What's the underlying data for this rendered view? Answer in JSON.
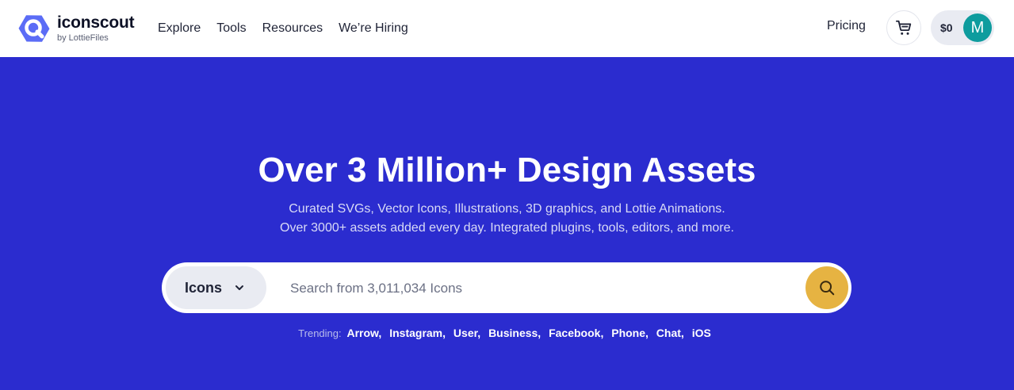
{
  "header": {
    "logo": {
      "name": "iconscout",
      "sub": "by LottieFiles"
    },
    "nav": [
      {
        "label": "Explore"
      },
      {
        "label": "Tools"
      },
      {
        "label": "Resources"
      },
      {
        "label": "We’re Hiring"
      }
    ],
    "pricing": "Pricing",
    "wallet_amount": "$0",
    "avatar_initial": "M",
    "colors": {
      "logo_accent": "#5b6cf6",
      "avatar_bg": "#0e9c9e"
    }
  },
  "hero": {
    "title": "Over 3 Million+ Design Assets",
    "subtitle_line1": "Curated SVGs, Vector Icons, Illustrations, 3D graphics, and Lottie Animations.",
    "subtitle_line2": "Over 3000+ assets added every day. Integrated plugins, tools, editors, and more.",
    "background_color": "#2b2ccf"
  },
  "search": {
    "type_selected": "Icons",
    "placeholder": "Search from 3,011,034 Icons",
    "value": "",
    "button_color": "#e6b342"
  },
  "trending": {
    "label": "Trending:",
    "items": [
      {
        "label": "Arrow,"
      },
      {
        "label": "Instagram,"
      },
      {
        "label": "User,"
      },
      {
        "label": "Business,"
      },
      {
        "label": "Facebook,"
      },
      {
        "label": "Phone,"
      },
      {
        "label": "Chat,"
      },
      {
        "label": "iOS"
      }
    ]
  }
}
